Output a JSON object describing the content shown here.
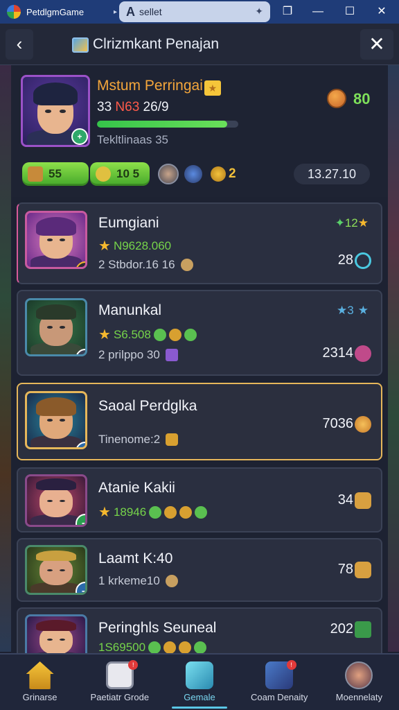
{
  "window": {
    "app_name": "PetdlgmGame",
    "tab_letter": "A",
    "tab_title": "sellet",
    "menu_chevron": "▸",
    "minimize": "—",
    "maximize": "☐",
    "close": "✕",
    "restore": "❐"
  },
  "header": {
    "back_icon": "‹",
    "title": "Clrizmkant Penajan",
    "close_icon": "✕"
  },
  "profile": {
    "name": "Mstum Perringai",
    "stats_prefix": "33 ",
    "stats_highlight": "N63",
    "stats_suffix": " 26/9",
    "xp_progress": 0.92,
    "subtitle": "Tekltlinaas 35",
    "coin_value": "80",
    "res_pill_1": "55",
    "res_pill_2": "10 5",
    "res_value": "2",
    "score": "13.27.10"
  },
  "players": [
    {
      "name": "Eumgiani",
      "line2": "N9628.060",
      "sub": "2 Stbdor.16 16",
      "value": "28",
      "top_right": "12",
      "badge": "⭡"
    },
    {
      "name": "Manunkal",
      "line2": "S6.508",
      "sub": "2 prilppo 30",
      "value": "2314",
      "top_right": "3",
      "badge": "↗"
    },
    {
      "name": "Saoal Perdglka",
      "line2": "",
      "sub": "Tinenome:2",
      "value": "7036",
      "top_right": "",
      "badge": "➜"
    },
    {
      "name": "Atanie Kakii",
      "line2": "18946",
      "sub": "",
      "value": "34",
      "top_right": "",
      "badge": "➜"
    },
    {
      "name": "Laamt K:40",
      "line2": "",
      "sub": "1 krkeme10",
      "value": "78",
      "top_right": "",
      "badge": "➜"
    },
    {
      "name": "Peringhls Seuneal",
      "line2": "1S69500",
      "sub": "",
      "value": "202",
      "top_right": "",
      "badge": ""
    }
  ],
  "nav": [
    {
      "label": "Grinarse"
    },
    {
      "label": "Paetiatr Grode"
    },
    {
      "label": "Gemale"
    },
    {
      "label": "Coam Denaity"
    },
    {
      "label": "Moennelaty"
    }
  ],
  "colors": {
    "accent_gold": "#e6b75a",
    "accent_green": "#76d44a",
    "accent_cyan": "#5ac7e6"
  }
}
